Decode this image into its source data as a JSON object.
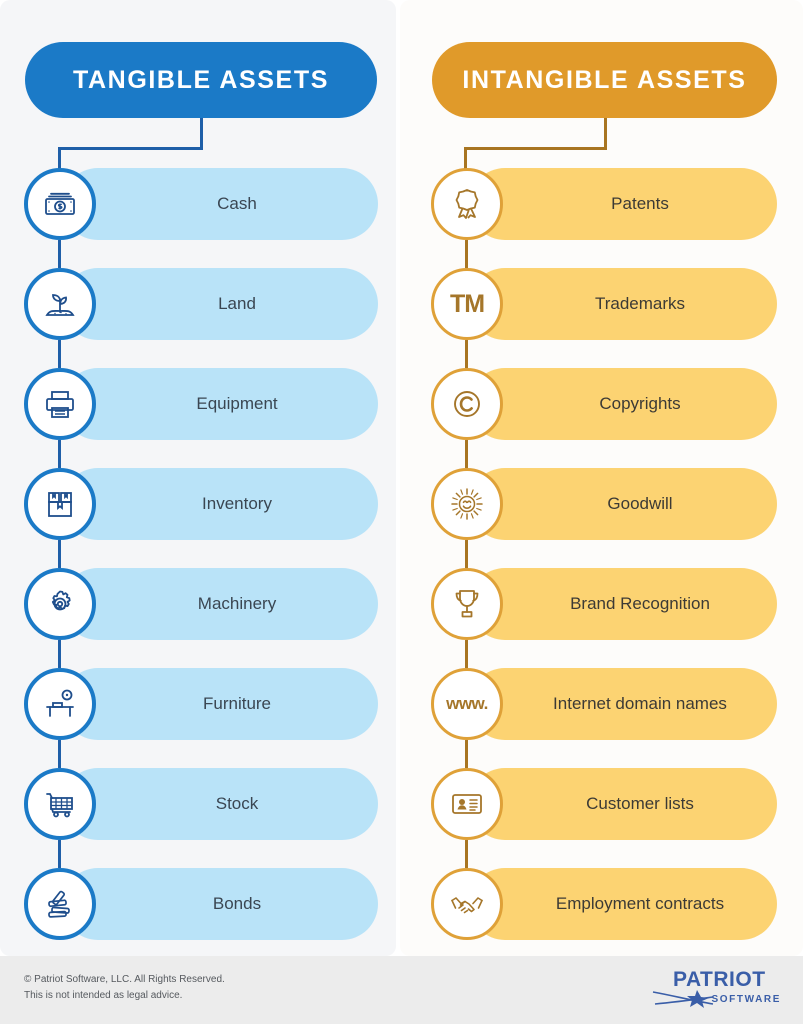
{
  "infographic": {
    "title_left": "TANGIBLE ASSETS",
    "title_right": "INTANGIBLE ASSETS",
    "colors": {
      "blue_header": "#1b7ac7",
      "blue_bar": "#b9e3f8",
      "blue_line": "#1f5fa8",
      "gold_header": "#e09a2a",
      "gold_bar": "#fcd372",
      "gold_line": "#a87521",
      "panel_left_bg": "#f5f6f8",
      "panel_right_bg": "#fdfcfa",
      "footer_bg": "#ececec",
      "label_text": "#3a4652"
    },
    "tangible": [
      {
        "label": "Cash",
        "icon": "banknote-icon"
      },
      {
        "label": "Land",
        "icon": "sprout-soil-icon"
      },
      {
        "label": "Equipment",
        "icon": "printer-icon"
      },
      {
        "label": "Inventory",
        "icon": "boxes-icon"
      },
      {
        "label": "Machinery",
        "icon": "gear-icon"
      },
      {
        "label": "Furniture",
        "icon": "desk-lamp-icon"
      },
      {
        "label": "Stock",
        "icon": "shopping-cart-icon"
      },
      {
        "label": "Bonds",
        "icon": "stacked-bars-icon"
      }
    ],
    "intangible": [
      {
        "label": "Patents",
        "icon": "award-ribbon-icon"
      },
      {
        "label": "Trademarks",
        "icon": "tm-icon",
        "glyph": "TM"
      },
      {
        "label": "Copyrights",
        "icon": "copyright-icon"
      },
      {
        "label": "Goodwill",
        "icon": "smiling-sun-icon"
      },
      {
        "label": "Brand Recognition",
        "icon": "trophy-icon"
      },
      {
        "label": "Internet domain names",
        "icon": "www-icon",
        "glyph": "www."
      },
      {
        "label": "Customer lists",
        "icon": "id-card-icon"
      },
      {
        "label": "Employment contracts",
        "icon": "handshake-icon"
      }
    ]
  },
  "footer": {
    "line1": "© Patriot Software, LLC. All Rights Reserved.",
    "line2": "This is not intended as legal advice.",
    "logo_word": "PATRIOT",
    "logo_sub": "SOFTWARE"
  }
}
